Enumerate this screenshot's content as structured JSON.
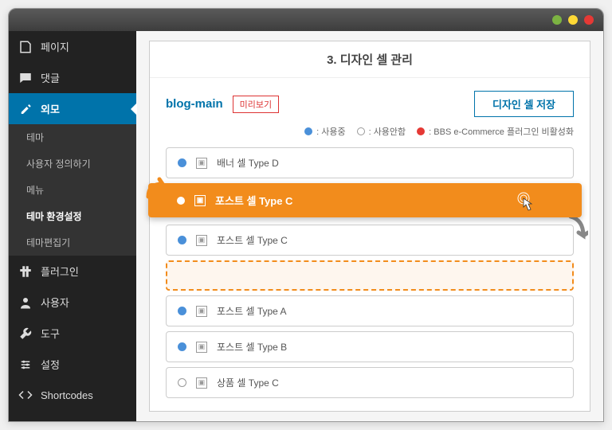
{
  "sidebar": {
    "items": [
      {
        "label": "페이지",
        "icon": "page"
      },
      {
        "label": "댓글",
        "icon": "comment"
      },
      {
        "label": "외모",
        "icon": "brush",
        "active": true
      },
      {
        "label": "플러그인",
        "icon": "plugin"
      },
      {
        "label": "사용자",
        "icon": "user"
      },
      {
        "label": "도구",
        "icon": "tool"
      },
      {
        "label": "설정",
        "icon": "settings"
      },
      {
        "label": "Shortcodes",
        "icon": "code"
      }
    ],
    "subitems": [
      {
        "label": "테마"
      },
      {
        "label": "사용자 정의하기"
      },
      {
        "label": "메뉴"
      },
      {
        "label": "테마 환경설정",
        "active": true
      },
      {
        "label": "테마편집기"
      }
    ]
  },
  "panel": {
    "title": "3. 디자인 셀 관리",
    "page_name": "blog-main",
    "preview_label": "미리보기",
    "save_label": "디자인 셀 저장"
  },
  "legend": {
    "active": ": 사용중",
    "inactive": ": 사용안함",
    "disabled": ": BBS e-Commerce 플러그인 비활성화"
  },
  "cells": [
    {
      "label": "배너 셀 Type D",
      "status": "blue"
    },
    {
      "label": "포스트 셀 Type C",
      "status": "blue",
      "dragging": true
    },
    {
      "label": "포스트 셀 Type C",
      "status": "blue"
    },
    {
      "label": "포스트 셀 Type A",
      "status": "blue"
    },
    {
      "label": "포스트 셀 Type B",
      "status": "blue"
    },
    {
      "label": "상품 셀 Type C",
      "status": "gray"
    }
  ]
}
